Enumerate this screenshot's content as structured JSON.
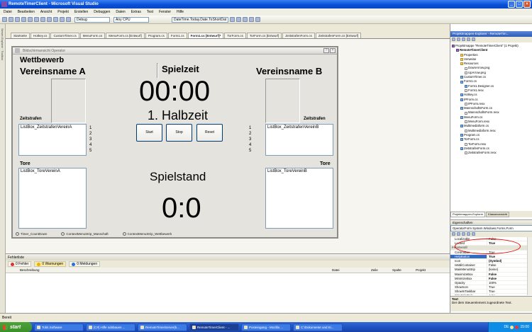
{
  "window": {
    "title": "RemoteTimerClient - Microsoft Visual Studio"
  },
  "menu": [
    "Datei",
    "Bearbeiten",
    "Ansicht",
    "Projekt",
    "Erstellen",
    "Debuggen",
    "Daten",
    "Extras",
    "Test",
    "Fenster",
    "Hilfe"
  ],
  "toolbar": {
    "config": "Debug",
    "platform": "Any CPU",
    "expression": "DateTime.Today.Date.ToShortDat"
  },
  "doc_tabs": [
    "Startseite",
    "Hotkey.cs",
    "CustomTimer.cs",
    "MenuForm.cs",
    "MenuForm.cs [Entwurf]",
    "Program.cs",
    "Form1.cs",
    "Form1.cs [Entwurf]*",
    "TorForm.cs",
    "TorForm.cs [Entwurf]",
    "ZeitstrafenForm.cs",
    "ZeitstrafenForm.cs [Entwurf]"
  ],
  "active_tab_index": 7,
  "form": {
    "title": "Bildschirmansicht Operator",
    "wettbewerb": "Wettbewerb",
    "team_a": "Vereinsname A",
    "team_b": "Vereinsname B",
    "spielzeit": "Spielzeit",
    "time": "00:00",
    "halbzeit": "1. Halbzeit",
    "zeitstrafen_a": "Zeitstrafen",
    "zeitstrafen_b": "Zeitstrafen",
    "list_zs_a": "ListBox_ZeitstrafenVereinA",
    "list_zs_b": "ListBox_ZeitstrafenVereinB",
    "nums": [
      "1",
      "2",
      "3",
      "4",
      "5"
    ],
    "btn_start": "Start",
    "btn_stop": "Stop",
    "btn_reset": "Reset",
    "tore_a": "Tore",
    "tore_b": "Tore",
    "list_tore_a": "ListBox_ToreVereinA",
    "list_tore_b": "ListBox_ToreVereinB",
    "spielstand": "Spielstand",
    "score": "0:0"
  },
  "tray": [
    "Timer_CountDown",
    "ContextMenuStrip_Manschaft",
    "ContextMenuStrip_Wettbewerb"
  ],
  "errors": {
    "title": "Fehlerliste",
    "tabs": [
      "0 Fehler",
      "0 Warnungen",
      "0 Meldungen"
    ],
    "columns": [
      "Beschreibung",
      "Datei",
      "Zeile",
      "Spalte",
      "Projekt"
    ]
  },
  "solution": {
    "title": "Projektmappen-Explorer - RemoteTim...",
    "items": [
      {
        "t": "Projektmappe \"RemoteTimerClient\" (1 Projekt)",
        "d": 0,
        "k": "proj"
      },
      {
        "t": "RemoteTimerClient",
        "d": 1,
        "k": "proj"
      },
      {
        "t": "Properties",
        "d": 2,
        "k": "folder"
      },
      {
        "t": "Verweise",
        "d": 2,
        "k": "folder"
      },
      {
        "t": "Resources",
        "d": 2,
        "k": "folder"
      },
      {
        "t": "DownArrow.png",
        "d": 3,
        "k": "file"
      },
      {
        "t": "UpArrow.png",
        "d": 3,
        "k": "file"
      },
      {
        "t": "CustomTimer.cs",
        "d": 2,
        "k": "cs"
      },
      {
        "t": "Form1.cs",
        "d": 2,
        "k": "cs"
      },
      {
        "t": "Form1.Designer.cs",
        "d": 3,
        "k": "cs"
      },
      {
        "t": "Form1.resx",
        "d": 3,
        "k": "file"
      },
      {
        "t": "Hotkey.cs",
        "d": 2,
        "k": "cs"
      },
      {
        "t": "IPForm.cs",
        "d": 2,
        "k": "cs"
      },
      {
        "t": "IPForm.resx",
        "d": 3,
        "k": "file"
      },
      {
        "t": "MannschaftsForm.cs",
        "d": 2,
        "k": "cs"
      },
      {
        "t": "MannschaftsForm.resx",
        "d": 3,
        "k": "file"
      },
      {
        "t": "MenuForm.cs",
        "d": 2,
        "k": "cs"
      },
      {
        "t": "MenuForm.resx",
        "d": 3,
        "k": "file"
      },
      {
        "t": "Multimediaform.cs",
        "d": 2,
        "k": "cs"
      },
      {
        "t": "Multimediaform.resx",
        "d": 3,
        "k": "file"
      },
      {
        "t": "Program.cs",
        "d": 2,
        "k": "cs"
      },
      {
        "t": "TorForm.cs",
        "d": 2,
        "k": "cs"
      },
      {
        "t": "TorForm.resx",
        "d": 3,
        "k": "file"
      },
      {
        "t": "ZeitstrafenForm.cs",
        "d": 2,
        "k": "cs"
      },
      {
        "t": "ZeitstrafenForm.resx",
        "d": 3,
        "k": "file"
      }
    ],
    "tabs": [
      "Projektmappen-Explorer",
      "Klassenansicht"
    ]
  },
  "properties": {
    "title": "Eigenschaften",
    "object": "OperatorForm System.Windows.Forms.Form",
    "rows": [
      {
        "n": "Localizable",
        "v": "False",
        "b": false
      },
      {
        "n": "Locked",
        "v": "True",
        "b": true
      },
      {
        "cat": "Fensterstil"
      },
      {
        "n": "ControlBox",
        "v": "True",
        "b": false
      },
      {
        "n": "HelpButton",
        "v": "True",
        "b": true,
        "sel": true
      },
      {
        "n": "Icon",
        "v": "(Symbol)",
        "b": true
      },
      {
        "n": "IsMdiContainer",
        "v": "False",
        "b": false
      },
      {
        "n": "MainMenuStrip",
        "v": "(keine)",
        "b": false
      },
      {
        "n": "MaximizeBox",
        "v": "False",
        "b": true
      },
      {
        "n": "MinimizeBox",
        "v": "False",
        "b": true
      },
      {
        "n": "Opacity",
        "v": "100%",
        "b": false
      },
      {
        "n": "ShowIcon",
        "v": "True",
        "b": false
      },
      {
        "n": "ShowInTaskbar",
        "v": "True",
        "b": false
      },
      {
        "n": "SizeGripStyle",
        "v": "Auto",
        "b": false
      }
    ],
    "desc_title": "Text",
    "desc": "Der dem Steuerelement zugeordnete Text."
  },
  "status": "Bereit",
  "taskbar": {
    "start": "start",
    "items": [
      "Tobit.Software",
      "[C#] Hilfe sobbauen ...",
      "RemoteTimerServer(k...",
      "RemoteTimerClient - ...",
      "Posteingang - Mozilla ...",
      "C:\\Dokumente und Ei..."
    ],
    "active": 3,
    "lang": "DE",
    "clock": "15:00"
  },
  "colors": {
    "highlight": "#e00000",
    "accent": "#0a50d8"
  }
}
